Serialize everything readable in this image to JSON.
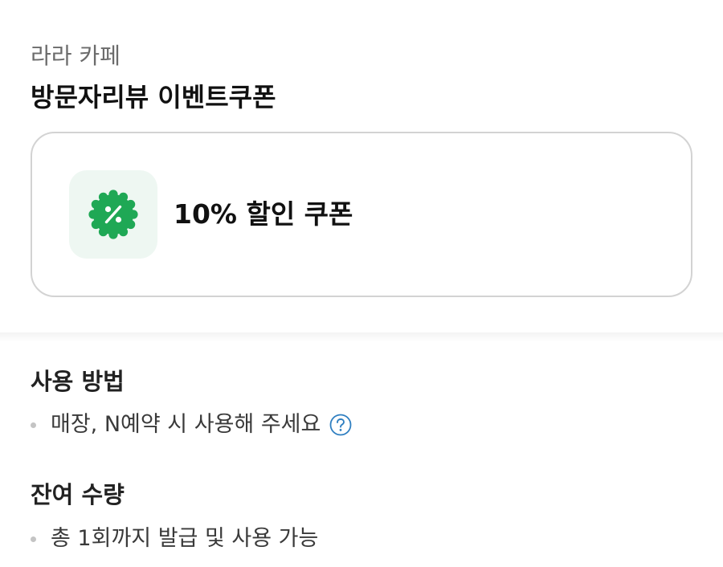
{
  "header": {
    "store_name": "라라 카페",
    "coupon_title": "방문자리뷰 이벤트쿠폰"
  },
  "coupon": {
    "icon": "percent-badge-icon",
    "label": "10% 할인 쿠폰",
    "accent_color": "#1fa855",
    "tile_color": "#eef7f2"
  },
  "usage": {
    "heading": "사용 방법",
    "item": "매장, N예약 시 사용해 주세요",
    "help_icon": "question-circle-icon",
    "help_color": "#2f7fc1"
  },
  "remaining": {
    "heading": "잔여 수량",
    "item": "총 1회까지 발급 및 사용 가능"
  }
}
